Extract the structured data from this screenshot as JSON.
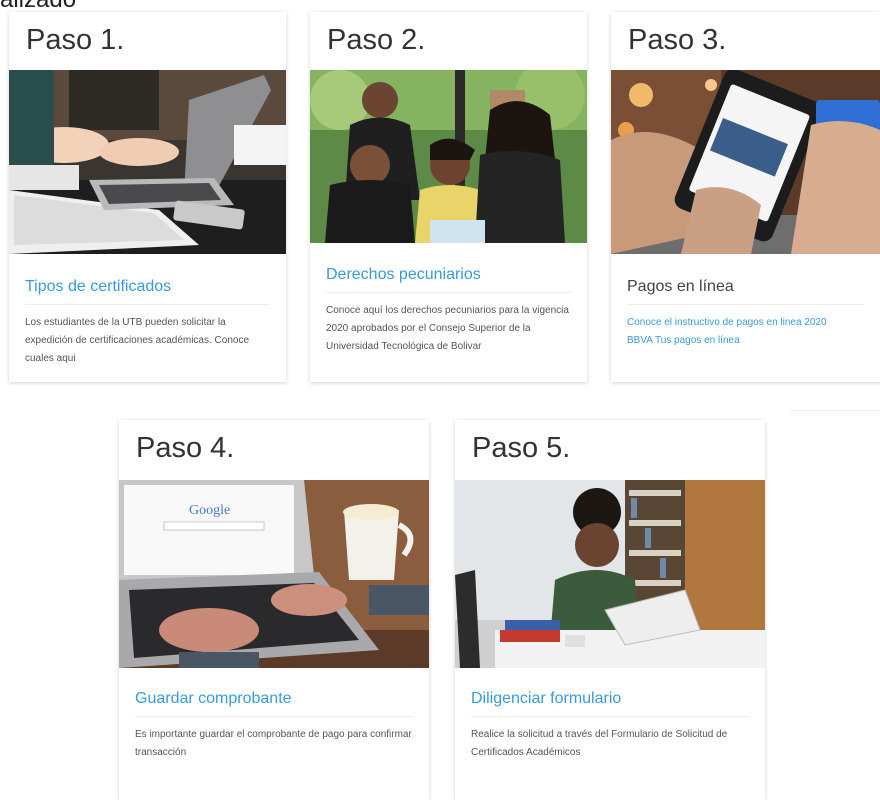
{
  "page": {
    "cutoff_text": "alizado"
  },
  "cards": [
    {
      "step": "Paso 1.",
      "image_alt": "Persona escribiendo en una laptop",
      "heading": "Tipos de certificados",
      "text": "Los estudiantes de la UTB pueden solicitar la expedición de certificaciones académicas. Conoce cuales aqui"
    },
    {
      "step": "Paso 2.",
      "image_alt": "Grupo de estudiantes sonriendo",
      "heading": "Derechos pecuniarios",
      "text": "Conoce aquí los derechos pecuniarios para la vigencia 2020 aprobados por el Consejo Superior de la Universidad Tecnológica de Bolivar"
    },
    {
      "step": "Paso 3.",
      "image_alt": "Pago con tarjeta en un teléfono móvil",
      "heading": "Pagos en línea",
      "links": [
        "Conoce el instructivo de pagos en linea 2020",
        "BBVA Tus pagos en línea"
      ]
    },
    {
      "step": "Paso 4.",
      "image_alt": "Manos en el teclado de una laptop con buscador",
      "heading": "Guardar comprobante",
      "text": "Es importante guardar el comprobante de pago para confirmar transacción"
    },
    {
      "step": "Paso 5.",
      "image_alt": "Estudiante usando laptop en biblioteca",
      "heading": "Diligenciar formulario",
      "text": "Realice la solicitud a través del Formulario de Solicitud de Certificados Académicos"
    }
  ],
  "image_text": {
    "google_logo": "Google"
  },
  "colors": {
    "link_blue": "#3a9ad9",
    "title_gray": "#333333"
  }
}
